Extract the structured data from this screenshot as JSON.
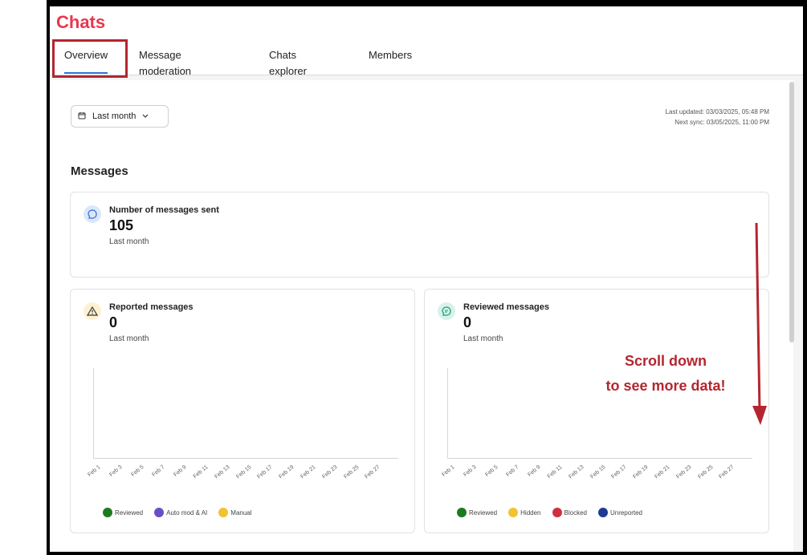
{
  "app": {
    "title": "Chats"
  },
  "tabs": [
    {
      "label": "Overview"
    },
    {
      "label": "Message moderation"
    },
    {
      "label": "Chats explorer"
    },
    {
      "label": "Members"
    }
  ],
  "filter": {
    "date_range": "Last month"
  },
  "sync": {
    "last_updated": "Last updated: 03/03/2025, 05:48 PM",
    "next_sync": "Next sync: 03/05/2025, 11:00 PM"
  },
  "messages_section": {
    "title": "Messages"
  },
  "cards": {
    "sent": {
      "label": "Number of messages sent",
      "value": "105",
      "period": "Last month",
      "icon": "chat-bubble-icon"
    },
    "reported": {
      "label": "Reported messages",
      "value": "0",
      "period": "Last month",
      "icon": "warning-icon"
    },
    "reviewed": {
      "label": "Reviewed messages",
      "value": "0",
      "period": "Last month",
      "icon": "reviewed-icon"
    }
  },
  "chart_data": [
    {
      "type": "line",
      "categories": [
        "Feb 1",
        "Feb 3",
        "Feb 5",
        "Feb 7",
        "Feb 9",
        "Feb 11",
        "Feb 13",
        "Feb 15",
        "Feb 17",
        "Feb 19",
        "Feb 21",
        "Feb 23",
        "Feb 25",
        "Feb 27"
      ],
      "series": [
        {
          "name": "Reviewed",
          "color": "#1e7a1e"
        },
        {
          "name": "Auto mod & AI",
          "color": "#6a4fc4"
        },
        {
          "name": "Manual",
          "color": "#f2c230"
        }
      ]
    },
    {
      "type": "line",
      "categories": [
        "Feb 1",
        "Feb 3",
        "Feb 5",
        "Feb 7",
        "Feb 9",
        "Feb 11",
        "Feb 13",
        "Feb 15",
        "Feb 17",
        "Feb 19",
        "Feb 21",
        "Feb 23",
        "Feb 25",
        "Feb 27"
      ],
      "series": [
        {
          "name": "Reviewed",
          "color": "#1e7a1e"
        },
        {
          "name": "Hidden",
          "color": "#f2c230"
        },
        {
          "name": "Blocked",
          "color": "#d12f3f"
        },
        {
          "name": "Unreported",
          "color": "#1f3a93"
        }
      ]
    }
  ],
  "annotation": {
    "line1": "Scroll down",
    "line2": "to see more data!"
  }
}
